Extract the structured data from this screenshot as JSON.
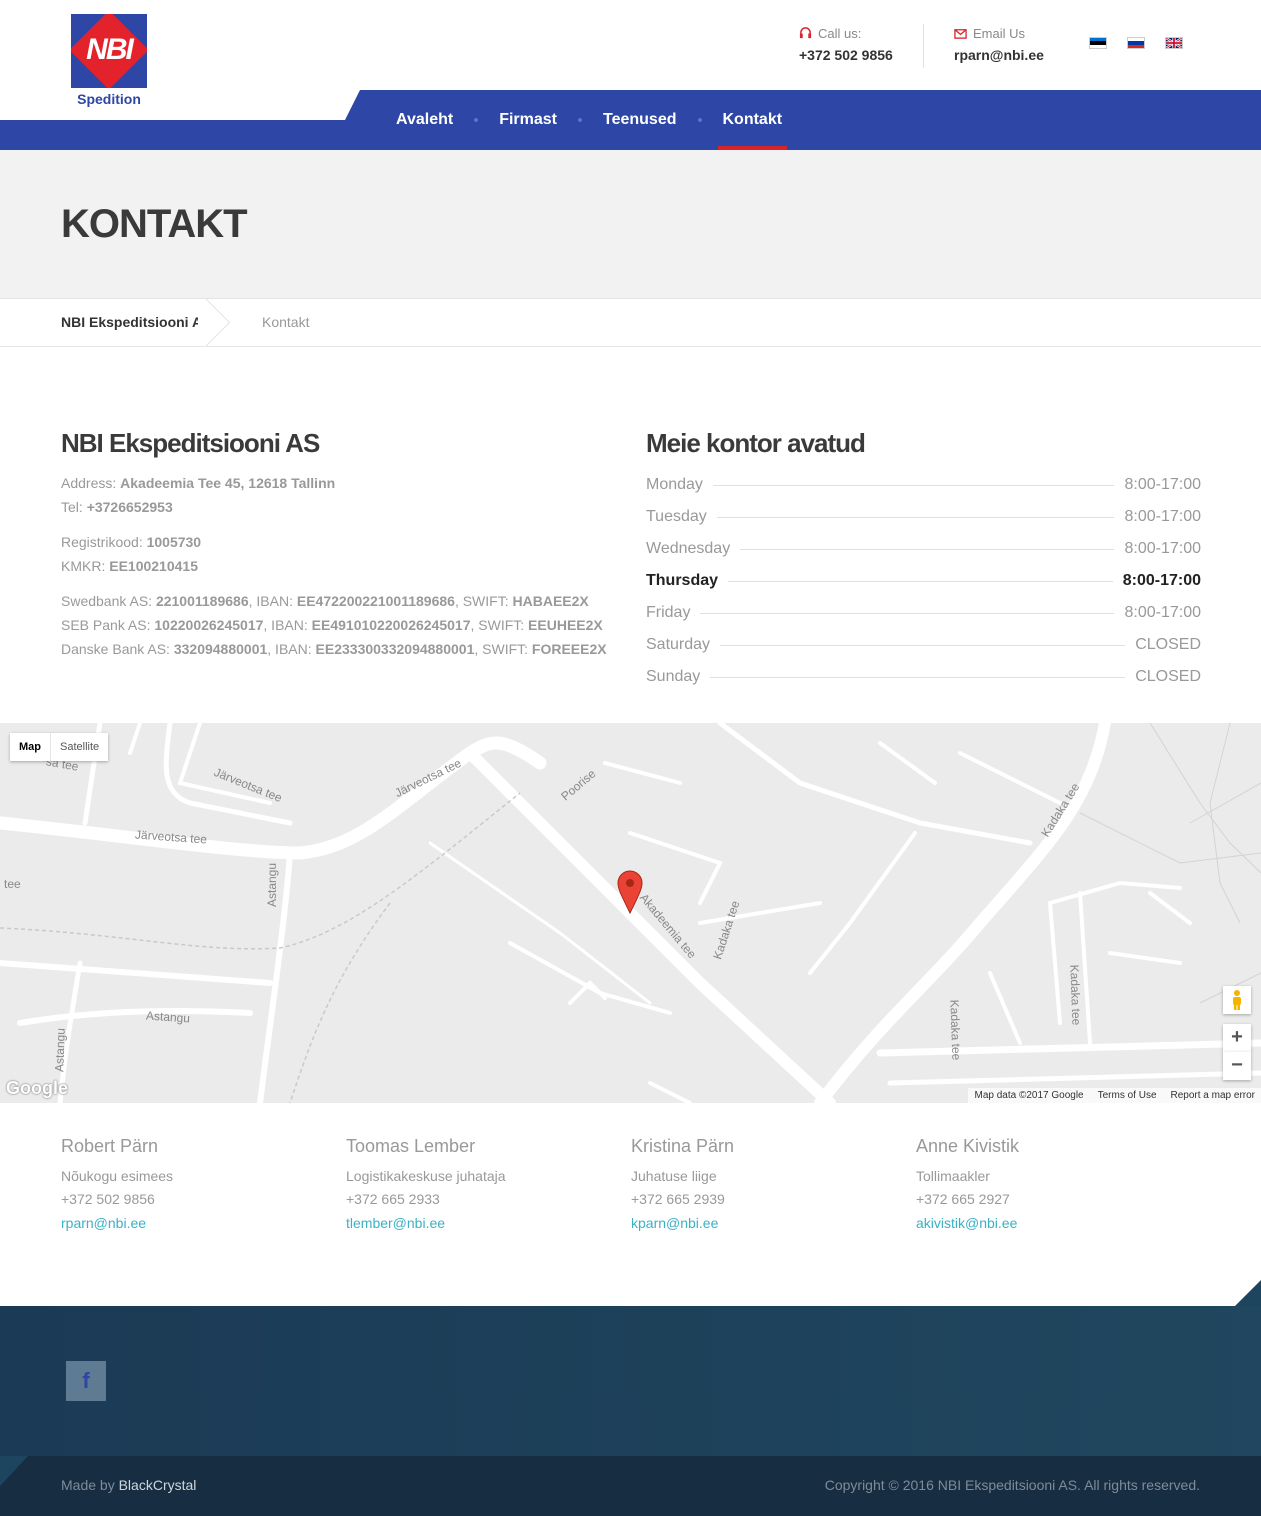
{
  "logo": {
    "mark": "NBI",
    "subtitle": "Spedition"
  },
  "header": {
    "call_label": "Call us:",
    "call_value": "+372 502 9856",
    "email_label": "Email Us",
    "email_value": "rparn@nbi.ee",
    "flags": [
      "estonia-flag-icon",
      "russia-flag-icon",
      "uk-flag-icon"
    ]
  },
  "nav": {
    "items": [
      {
        "label": "Avaleht"
      },
      {
        "label": "Firmast"
      },
      {
        "label": "Teenused"
      },
      {
        "label": "Kontakt"
      }
    ],
    "active": "Kontakt"
  },
  "page": {
    "title": "KONTAKT"
  },
  "breadcrumb": {
    "home": "NBI Ekspeditsiooni AS",
    "current": "Kontakt"
  },
  "company": {
    "name": "NBI Ekspeditsiooni AS",
    "address_label": "Address:",
    "address": "Akadeemia Tee 45, 12618 Tallinn",
    "tel_label": "Tel:",
    "tel": "+3726652953",
    "reg_label": "Registrikood:",
    "reg": "1005730",
    "kmkr_label": "KMKR:",
    "kmkr": "EE100210415",
    "banks": [
      {
        "bank": "Swedbank AS:",
        "account": "221001189686",
        "iban_label": ", IBAN:",
        "iban": "EE472200221001189686",
        "swift_label": ", SWIFT:",
        "swift": "HABAEE2X"
      },
      {
        "bank": "SEB Pank AS:",
        "account": "10220026245017",
        "iban_label": ", IBAN:",
        "iban": "EE491010220026245017",
        "swift_label": ", SWIFT:",
        "swift": "EEUHEE2X"
      },
      {
        "bank": "Danske Bank AS:",
        "account": "332094880001",
        "iban_label": ", IBAN:",
        "iban": "EE233300332094880001",
        "swift_label": ", SWIFT:",
        "swift": "FOREEE2X"
      }
    ]
  },
  "hours": {
    "title": "Meie kontor avatud",
    "days": [
      {
        "day": "Monday",
        "time": "8:00-17:00"
      },
      {
        "day": "Tuesday",
        "time": "8:00-17:00"
      },
      {
        "day": "Wednesday",
        "time": "8:00-17:00"
      },
      {
        "day": "Thursday",
        "time": "8:00-17:00"
      },
      {
        "day": "Friday",
        "time": "8:00-17:00"
      },
      {
        "day": "Saturday",
        "time": "CLOSED"
      },
      {
        "day": "Sunday",
        "time": "CLOSED"
      }
    ],
    "today": "Thursday"
  },
  "map": {
    "toggle_map": "Map",
    "toggle_satellite": "Satellite",
    "google": "Google",
    "attribution": "Map data ©2017 Google",
    "terms": "Terms of Use",
    "report": "Report a map error",
    "roads": {
      "jarveotsa1": "Järveotsa tee",
      "jarveotsa2": "Järveotsa tee",
      "jarveotsa3": "Järveotsa tee",
      "astangu1": "Astangu",
      "astangu2": "Astangu",
      "astangu3": "Astangu",
      "akadeemia": "Akadeemia tee",
      "kadaka1": "Kadaka tee",
      "kadaka2": "Kadaka tee",
      "kadaka3": "Kadaka tee",
      "kadaka4": "Kadaka tee",
      "poorise": "Poorise",
      "tee": "tee",
      "sa_tee": "sa tee"
    }
  },
  "people": [
    {
      "name": "Robert Pärn",
      "role": "Nõukogu esimees",
      "phone": "+372 502 9856",
      "email": "rparn@nbi.ee"
    },
    {
      "name": "Toomas Lember",
      "role": "Logistikakeskuse juhataja",
      "phone": "+372 665 2933",
      "email": "tlember@nbi.ee"
    },
    {
      "name": "Kristina Pärn",
      "role": "Juhatuse liige",
      "phone": "+372 665 2939",
      "email": "kparn@nbi.ee"
    },
    {
      "name": "Anne Kivistik",
      "role": "Tollimaakler",
      "phone": "+372 665 2927",
      "email": "akivistik@nbi.ee"
    }
  ],
  "footer": {
    "facebook_glyph": "f",
    "made_by": "Made by",
    "made_by_link": "BlackCrystal",
    "copyright": "Copyright © 2016 NBI Ekspeditsiooni AS. All rights reserved."
  }
}
